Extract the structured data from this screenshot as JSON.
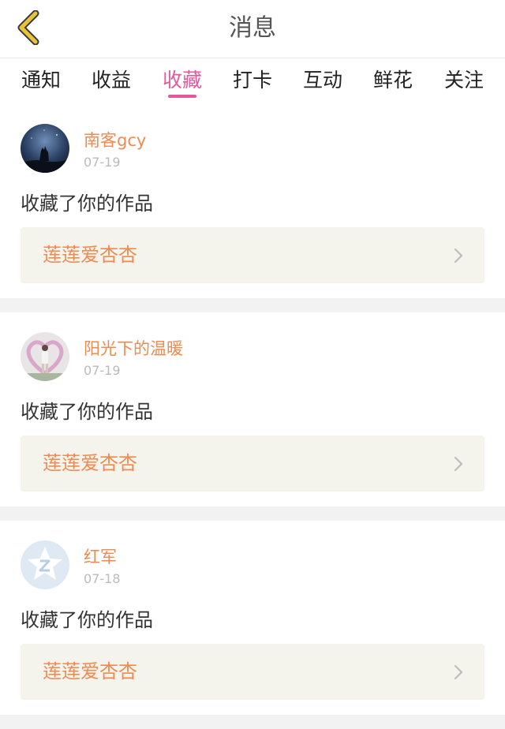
{
  "header": {
    "title": "消息"
  },
  "tabs": [
    {
      "label": "通知",
      "active": false
    },
    {
      "label": "收益",
      "active": false
    },
    {
      "label": "收藏",
      "active": true
    },
    {
      "label": "打卡",
      "active": false
    },
    {
      "label": "互动",
      "active": false
    },
    {
      "label": "鲜花",
      "active": false
    },
    {
      "label": "关注",
      "active": false
    }
  ],
  "colors": {
    "accent": "#e25a9c",
    "username": "#f08a50",
    "work_title": "#f08a50",
    "box_bg": "#f4f3ec",
    "back_arrow": "#e7c43a"
  },
  "feed": [
    {
      "username": "南客gcy",
      "date": "07-19",
      "action": "收藏了你的作品",
      "work_title": "莲莲爱杏杏",
      "avatar": "night-wolf-avatar"
    },
    {
      "username": "阳光下的温暖",
      "date": "07-19",
      "action": "收藏了你的作品",
      "work_title": "莲莲爱杏杏",
      "avatar": "person-heart-avatar"
    },
    {
      "username": "红军",
      "date": "07-18",
      "action": "收藏了你的作品",
      "work_title": "莲莲爱杏杏",
      "avatar": "default-z-star-avatar"
    }
  ]
}
